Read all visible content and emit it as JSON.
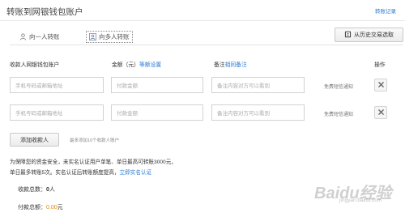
{
  "header": {
    "title": "转账到网银钱包账户",
    "history_link": "转账记录"
  },
  "tabs": [
    {
      "label": "向一人转账",
      "icon": "person-icon",
      "selected": false
    },
    {
      "label": "向多人转账",
      "icon": "people-icon",
      "selected": true
    }
  ],
  "history_button": {
    "label": "从历史交易选取",
    "icon": "contacts-book-icon"
  },
  "columns": {
    "account": "收款人网银钱包账户",
    "amount": "金额（元）",
    "amount_link": "等额设置",
    "remark": "备注",
    "remark_link": "相同备注",
    "action": "操作"
  },
  "rows": [
    {
      "account_placeholder": "手机号码或邮箱地址",
      "amount_placeholder": "付款金额",
      "remark_placeholder": "备注内容对方可以看到",
      "sms": "免费短信通知"
    },
    {
      "account_placeholder": "手机号码或邮箱地址",
      "amount_placeholder": "付款金额",
      "remark_placeholder": "备注内容对方可以看到",
      "sms": "免费短信通知"
    }
  ],
  "add_button": "添加收款人",
  "add_hint": "最多添加10个收款人账户",
  "notice": {
    "line1": "为保障您的资金安全，未实名认证用户单笔、单日最高可转账3000元，",
    "line2": "单日最多转账5次。实名认证后转账额度提高，",
    "link": "立即实名认证"
  },
  "summary": {
    "count_label": "收款总数：",
    "count_value": "0",
    "count_unit": "人",
    "amount_label": "付款总额：",
    "amount_value": "0.00",
    "amount_unit": "元"
  },
  "watermark": {
    "main": "Baidu经验",
    "sub": "jingyan.baidu.com"
  }
}
